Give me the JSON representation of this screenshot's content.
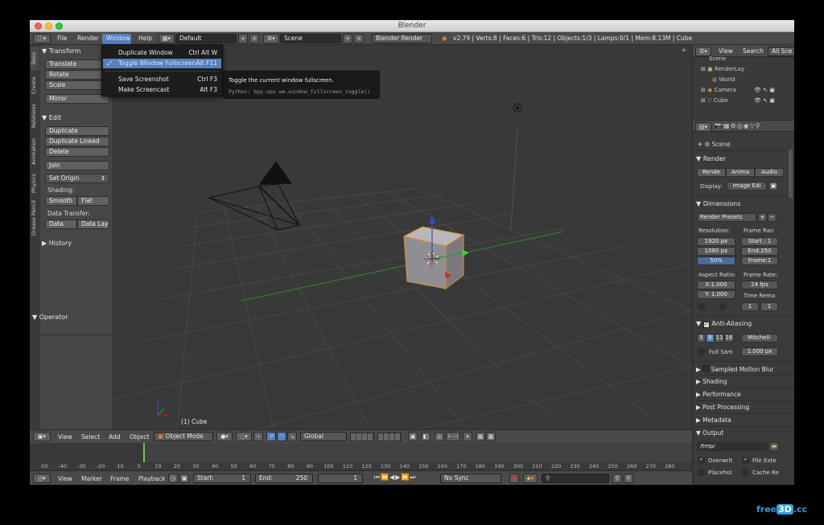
{
  "window": {
    "title": "Blender"
  },
  "topbar": {
    "menus": [
      "File",
      "Render",
      "Window",
      "Help"
    ],
    "layout": "Default",
    "scene": "Scene",
    "engine": "Blender Render",
    "stats": "v2.79 | Verts:8 | Faces:6 | Tris:12 | Objects:1/3 | Lamps:0/1 | Mem:8.13M | Cube"
  },
  "window_menu": {
    "items": [
      {
        "label": "Duplicate Window",
        "shortcut": "Ctrl Alt W"
      },
      {
        "label": "Toggle Window Fullscreen",
        "shortcut": "Alt F11"
      },
      {
        "label": "Save Screenshot",
        "shortcut": "Ctrl F3"
      },
      {
        "label": "Make Screencast",
        "shortcut": "Alt F3"
      }
    ]
  },
  "tooltip": {
    "title": "Toggle the current window fullscreen.",
    "python": "Python: bpy.ops.wm.window_fullscreen_toggle()"
  },
  "left_tabs": [
    "Tools",
    "Create",
    "Relations",
    "Animation",
    "Physics",
    "Grease Pencil"
  ],
  "toolshelf": {
    "transform": {
      "header": "Transform",
      "buttons": [
        "Translate",
        "Rotate",
        "Scale",
        "Mirror"
      ]
    },
    "edit": {
      "header": "Edit",
      "buttons": [
        "Duplicate",
        "Duplicate Linked",
        "Delete",
        "Join",
        "Set Origin"
      ]
    },
    "shading_label": "Shading:",
    "shading": [
      "Smooth",
      "Flat"
    ],
    "data_transfer_label": "Data Transfer:",
    "data_transfer": [
      "Data",
      "Data Layo"
    ],
    "history": "History",
    "operator": "Operator"
  },
  "viewport": {
    "object_label": "(1) Cube"
  },
  "outliner": {
    "menus": [
      "View",
      "Search"
    ],
    "filter": "All Sce",
    "items": [
      "Scene",
      "RenderLay",
      "World",
      "Camera",
      "Cube"
    ]
  },
  "properties": {
    "context": "Scene",
    "render": {
      "header": "Render",
      "buttons": [
        "Rende",
        "Anima",
        "Audio"
      ],
      "display_label": "Display:",
      "display_value": "Image Edi"
    },
    "dimensions": {
      "header": "Dimensions",
      "presets": "Render Presets",
      "resolution_label": "Resolution:",
      "frame_range_label": "Frame Ran",
      "res_x": "1920 px",
      "res_y": "1080 px",
      "res_pct": "50%",
      "start": "Start : 1",
      "end": "End:250",
      "frame_step": "Frame:1",
      "aspect_label": "Aspect Ratio:",
      "frame_rate_label": "Frame Rate:",
      "aspect_x": "X:1.000",
      "aspect_y": "Y: 1.000",
      "fps": "24 fps",
      "time_remap_label": "Time Rema",
      "remap_old": "1",
      "remap_new": "1"
    },
    "anti_aliasing": {
      "header": "Anti-Aliasing",
      "samples": [
        "5",
        "8",
        "11",
        "16"
      ],
      "filter": "Mitchell-",
      "full_sample": "Full Sam",
      "size": "1.000 px"
    },
    "collapsed": [
      "Sampled Motion Blur",
      "Shading",
      "Performance",
      "Post Processing",
      "Metadata"
    ],
    "output": {
      "header": "Output",
      "path": "/tmp/",
      "overwrite": "Overwrit",
      "file_ext": "File Exte",
      "placeholders": "Placehol",
      "cache": "Cache Re"
    }
  },
  "view3d_header": {
    "menus": [
      "View",
      "Select",
      "Add",
      "Object"
    ],
    "mode": "Object Mode",
    "orientation": "Global"
  },
  "timeline": {
    "ticks": [
      "-50",
      "-40",
      "-30",
      "-20",
      "-10",
      "0",
      "10",
      "20",
      "30",
      "40",
      "50",
      "60",
      "70",
      "80",
      "90",
      "100",
      "110",
      "120",
      "130",
      "140",
      "150",
      "160",
      "170",
      "180",
      "190",
      "200",
      "210",
      "220",
      "230",
      "240",
      "250",
      "260",
      "270",
      "280"
    ],
    "menus": [
      "View",
      "Marker",
      "Frame",
      "Playback"
    ],
    "start": "Start:",
    "start_value": "1",
    "end": "End:",
    "end_value": "250",
    "current": "1",
    "sync": "No Sync"
  },
  "watermark": {
    "a": "free",
    "b": "3D",
    "c": ".cc"
  }
}
